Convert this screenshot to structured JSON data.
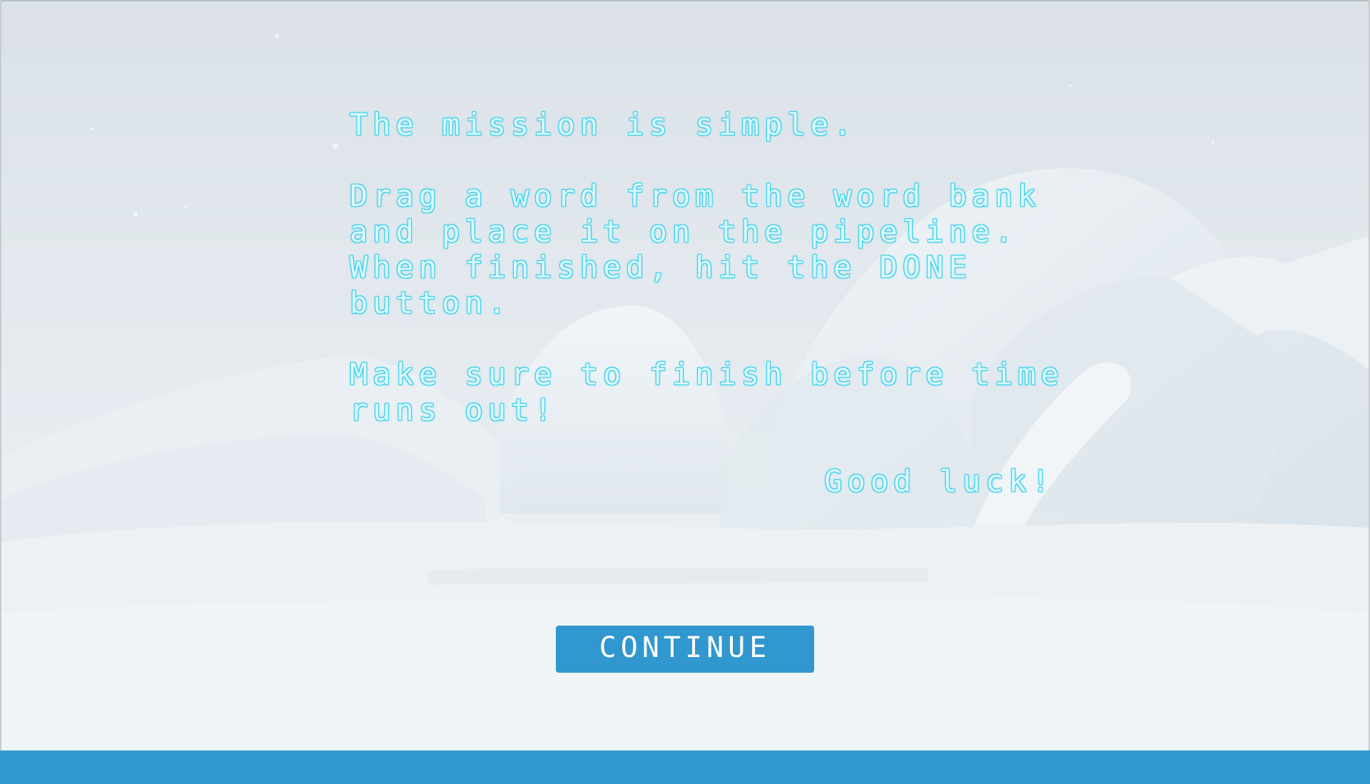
{
  "colors": {
    "text_glow": "#2fd3ee",
    "text_fill": "#def8fc",
    "button_bg": "#3197cf",
    "button_text": "#ffffff",
    "bottom_bar": "#2f98cf",
    "background": "#dfe6ec"
  },
  "intro": {
    "line1": "The mission is simple.",
    "line2": "Drag a word from the word bank",
    "line3": "and place it on the pipeline.",
    "line4": "When finished, hit the DONE",
    "line5": "button.",
    "line6": "Make sure to finish before time",
    "line7": "runs out!",
    "sign_off": "Good luck!"
  },
  "continue_label": "CONTINUE"
}
